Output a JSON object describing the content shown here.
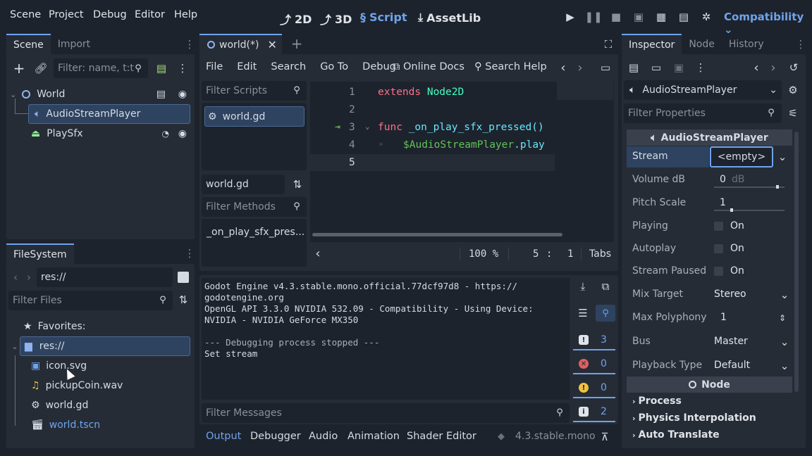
{
  "menu": [
    "Scene",
    "Project",
    "Debug",
    "Editor",
    "Help"
  ],
  "modes": [
    "2D",
    "3D",
    "Script",
    "AssetLib"
  ],
  "renderer": "Compatibility",
  "scene_dock": {
    "tabs": [
      "Scene",
      "Import"
    ],
    "filter_placeholder": "Filter: name, t:t",
    "nodes": [
      "World",
      "AudioStreamPlayer",
      "PlaySfx"
    ]
  },
  "filesystem": {
    "tab": "FileSystem",
    "path": "res://",
    "filter_placeholder": "Filter Files",
    "favorites": "Favorites:",
    "root": "res://",
    "files": [
      "icon.svg",
      "pickupCoin.wav",
      "world.gd",
      "world.tscn"
    ]
  },
  "script_editor": {
    "tab": "world(*)",
    "menu": [
      "File",
      "Edit",
      "Search",
      "Go To",
      "Debug"
    ],
    "online_docs": "Online Docs",
    "search_help": "Search Help",
    "filter_scripts": "Filter Scripts",
    "scripts": [
      "world.gd"
    ],
    "current_script": "world.gd",
    "filter_methods": "Filter Methods",
    "methods": [
      "_on_play_sfx_pres..."
    ],
    "line_numbers": [
      "1",
      "2",
      "3",
      "4",
      "5"
    ],
    "code": {
      "l1_kw": "extends",
      "l1_type": "Node2D",
      "l3_kw": "func",
      "l3_name": "_on_play_sfx_pressed()",
      "l4_node": "$AudioStreamPlayer",
      "l4_method": ".play"
    },
    "zoom": "100 %",
    "line": "5",
    "col": "1",
    "indent": "Tabs"
  },
  "output": {
    "lines": [
      "Godot Engine v4.3.stable.mono.official.77dcf97d8 - https://",
      "godotengine.org",
      "OpenGL API 3.3.0 NVIDIA 532.09 - Compatibility - Using Device:",
      "NVIDIA - NVIDIA GeForce MX350",
      "",
      "--- Debugging process stopped ---",
      "Set stream"
    ],
    "filter_placeholder": "Filter Messages",
    "counts": [
      "3",
      "0",
      "0",
      "2"
    ],
    "count_colors": [
      "#e0e4ea",
      "#e06060",
      "#f0c040",
      "#e0e4ea"
    ]
  },
  "bottom_tabs": [
    "Output",
    "Debugger",
    "Audio",
    "Animation",
    "Shader Editor"
  ],
  "version": "4.3.stable.mono",
  "inspector": {
    "tabs": [
      "Inspector",
      "Node",
      "History"
    ],
    "object": "AudioStreamPlayer",
    "filter_placeholder": "Filter Properties",
    "class_header": "AudioStreamPlayer",
    "stream_label": "Stream",
    "stream_value": "<empty>",
    "volume_label": "Volume dB",
    "volume_value": "0",
    "volume_unit": "dB",
    "volume_fill": 0.9,
    "pitch_label": "Pitch Scale",
    "pitch_value": "1",
    "pitch_fill": 0.25,
    "playing_label": "Playing",
    "autoplay_label": "Autoplay",
    "paused_label": "Stream Paused",
    "on_text": "On",
    "mix_label": "Mix Target",
    "mix_value": "Stereo",
    "poly_label": "Max Polyphony",
    "poly_value": "1",
    "bus_label": "Bus",
    "bus_value": "Master",
    "pbtype_label": "Playback Type",
    "pbtype_value": "Default",
    "node_header": "Node",
    "sections": [
      "Process",
      "Physics Interpolation",
      "Auto Translate"
    ]
  },
  "colors": {
    "accent": "#6fa3ec",
    "keyword": "#ff7085",
    "type": "#42ffc2",
    "function": "#66e6ff",
    "node_path": "#63c259"
  }
}
